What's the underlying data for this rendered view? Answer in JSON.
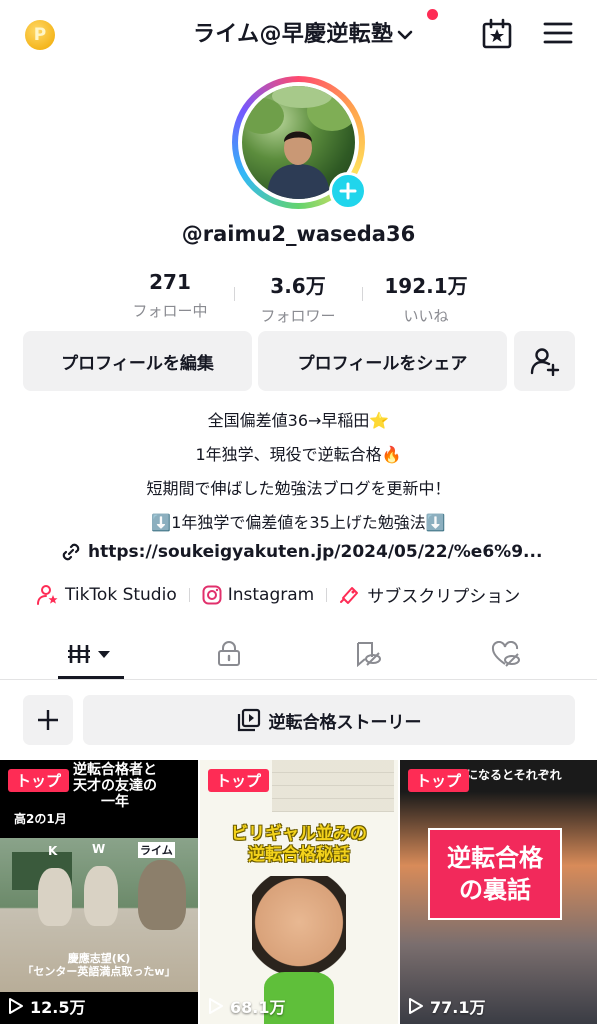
{
  "header": {
    "title": "ライム@早慶逆転塾",
    "coin_label": "P"
  },
  "profile": {
    "username": "@raimu2_waseda36"
  },
  "stats": [
    {
      "value": "271",
      "label": "フォロー中"
    },
    {
      "value": "3.6万",
      "label": "フォロワー"
    },
    {
      "value": "192.1万",
      "label": "いいね"
    }
  ],
  "actions": {
    "edit_profile": "プロフィールを編集",
    "share_profile": "プロフィールをシェア"
  },
  "bio": {
    "line1": "全国偏差値36→早稲田⭐",
    "line2": "1年独学、現役で逆転合格🔥",
    "line3": "短期間で伸ばした勉強法ブログを更新中！",
    "line4": "⬇️1年独学で偏差値を35上げた勉強法⬇️",
    "link": "https://soukeigyakuten.jp/2024/05/22/%e6%9..."
  },
  "quick_links": {
    "studio": "TikTok Studio",
    "instagram": "Instagram",
    "subscription": "サブスクリプション"
  },
  "story": {
    "label": "逆転合格ストーリー"
  },
  "videos": [
    {
      "badge": "トップ",
      "views": "12.5万",
      "text1": "逆転合格者と",
      "text2": "天才の友達の",
      "text3": "一年",
      "text4": "高2の1月",
      "caption1": "慶應志望(K)",
      "caption2": "「センター英語満点取ったw」",
      "label_k": "K",
      "label_w": "W",
      "label_raimu": "ライム"
    },
    {
      "badge": "トップ",
      "views": "68.1万",
      "headline1": "ビリギャル並みの",
      "headline2": "逆転合格秘話"
    },
    {
      "badge": "トップ",
      "views": "77.1万",
      "top_text": "になるとそれぞれ",
      "card1": "逆転合格",
      "card2": "の裏話"
    }
  ]
}
